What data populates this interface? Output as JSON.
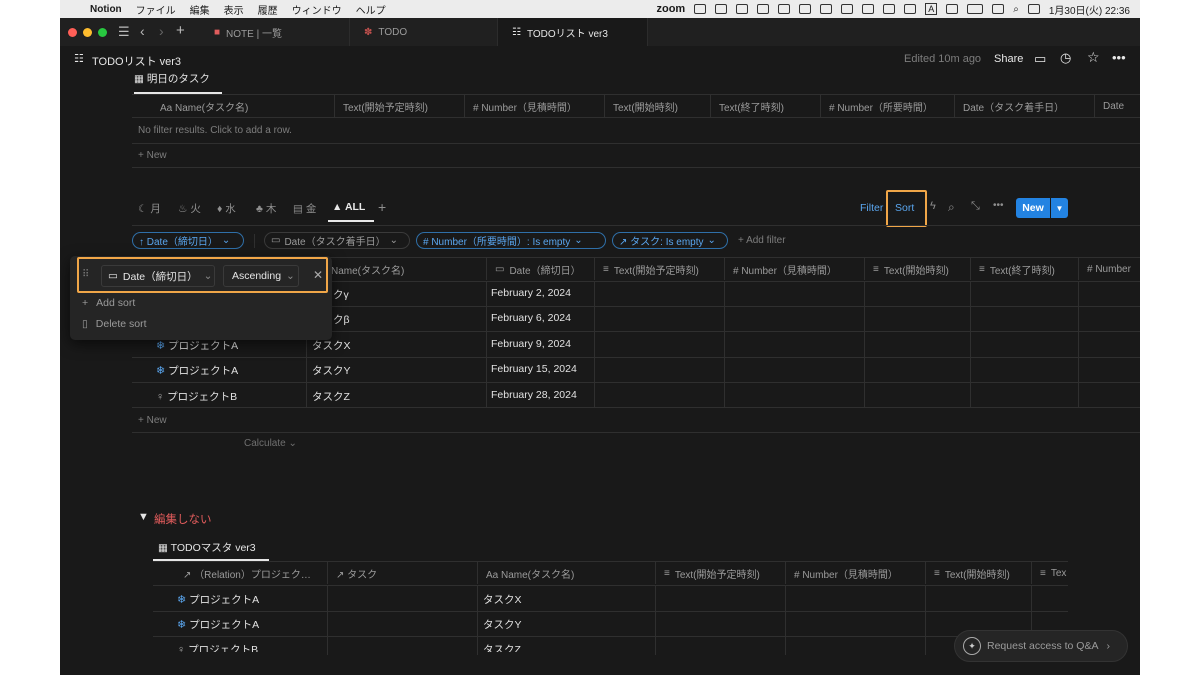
{
  "menubar": {
    "app": "Notion",
    "items": [
      "ファイル",
      "編集",
      "表示",
      "履歴",
      "ウィンドウ",
      "ヘルプ"
    ],
    "zoom": "zoom",
    "clock": "1月30日(火) 22:36",
    "input_mode": "A"
  },
  "tabs": [
    {
      "label": "NOTE | 一覧",
      "active": false
    },
    {
      "label": "TODO",
      "active": false
    },
    {
      "label": "TODOリスト ver3",
      "active": true
    }
  ],
  "page": {
    "title": "TODOリスト ver3",
    "edited": "Edited 10m ago",
    "share": "Share"
  },
  "db1": {
    "title": "明日のタスク",
    "columns": [
      "Aa Name(タスク名)",
      "Text(開始予定時刻)",
      "# Number（見積時間）",
      "Text(開始時刻)",
      "Text(終了時刻)",
      "# Number（所要時間）",
      "Date（タスク着手日）",
      "Date"
    ],
    "empty": "No filter results. Click to add a row.",
    "new": "+ New"
  },
  "views": {
    "tabs": [
      "月",
      "火",
      "水",
      "木",
      "金",
      "ALL"
    ],
    "active": "ALL",
    "filter": "Filter",
    "sort": "Sort",
    "new_button": "New"
  },
  "filters": {
    "chips": [
      "↑ Date（締切日）",
      "Date（タスク着手日）",
      "# Number（所要時間）: Is empty",
      "↗ タスク: Is empty"
    ],
    "add": "+ Add filter"
  },
  "sort_popup": {
    "property": "Date（締切日）",
    "direction": "Ascending",
    "add_sort": "Add sort",
    "delete_sort": "Delete sort"
  },
  "db2": {
    "columns": [
      "Name(タスク名)",
      "Date（締切日）",
      "Text(開始予定時刻)",
      "# Number（見積時間）",
      "Text(開始時刻)",
      "Text(終了時刻)",
      "# Number"
    ],
    "rows": [
      {
        "project": "",
        "task": "タスクγ",
        "date": "February 2, 2024"
      },
      {
        "project": "",
        "task": "タスクβ",
        "date": "February 6, 2024"
      },
      {
        "project": "プロジェクトA",
        "task": "タスクX",
        "date": "February 9, 2024"
      },
      {
        "project": "プロジェクトA",
        "task": "タスクY",
        "date": "February 15, 2024"
      },
      {
        "project": "プロジェクトB",
        "task": "タスクZ",
        "date": "February 28, 2024"
      }
    ],
    "new": "+ New",
    "calculate": "Calculate"
  },
  "toggle": {
    "label": "編集しない"
  },
  "db3": {
    "title": "TODOマスタ ver3",
    "columns": [
      "↗ （Relation）プロジェク…",
      "↗ タスク",
      "Aa Name(タスク名)",
      "Text(開始予定時刻)",
      "# Number（見積時間）",
      "Text(開始時刻)",
      "Tex"
    ],
    "rows": [
      {
        "project": "プロジェクトA",
        "name": "タスクX"
      },
      {
        "project": "プロジェクトA",
        "name": "タスクY"
      },
      {
        "project": "プロジェクトB",
        "name": "タスクZ"
      }
    ]
  },
  "qa": {
    "label": "Request access to Q&A"
  },
  "colors": {
    "accent": "#2383e2",
    "highlight": "#f0a648",
    "background": "#191919"
  }
}
